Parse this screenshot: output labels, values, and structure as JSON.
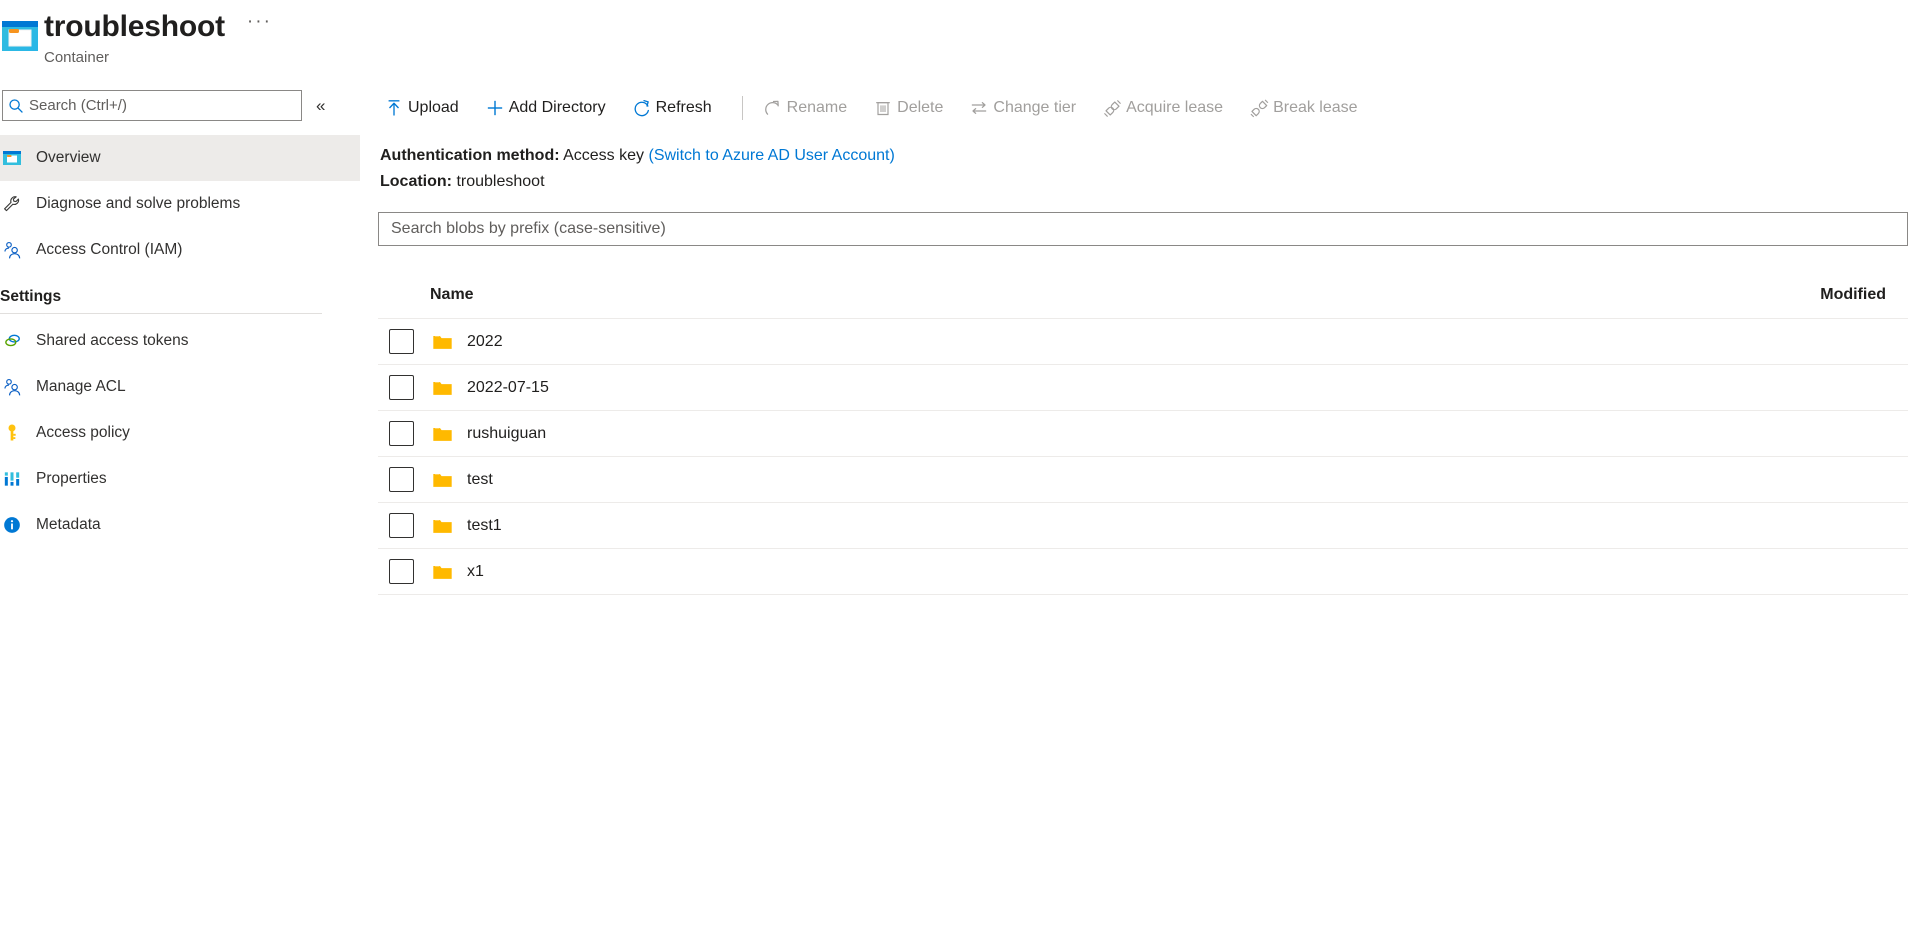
{
  "sidebar": {
    "icon": "storage-container-icon",
    "title": "troubleshoot",
    "subtitle": "Container",
    "more_label": "···",
    "search": {
      "placeholder": "Search (Ctrl+/)",
      "value": "",
      "icon": "search-icon"
    },
    "collapse_label": "«",
    "nav": [
      {
        "label": "Overview",
        "icon": "container-icon",
        "selected": true
      },
      {
        "label": "Diagnose and solve problems",
        "icon": "wrench-icon",
        "selected": false
      },
      {
        "label": "Access Control (IAM)",
        "icon": "people-icon",
        "selected": false
      }
    ],
    "section_title": "Settings",
    "settings": [
      {
        "label": "Shared access tokens",
        "icon": "link-chain-icon"
      },
      {
        "label": "Manage ACL",
        "icon": "people-icon"
      },
      {
        "label": "Access policy",
        "icon": "key-icon"
      },
      {
        "label": "Properties",
        "icon": "sliders-icon"
      },
      {
        "label": "Metadata",
        "icon": "info-circle-icon"
      }
    ]
  },
  "toolbar": {
    "buttons": [
      {
        "label": "Upload",
        "icon": "upload-icon",
        "disabled": false
      },
      {
        "label": "Add Directory",
        "icon": "plus-icon",
        "disabled": false
      },
      {
        "label": "Refresh",
        "icon": "refresh-icon",
        "disabled": false
      }
    ],
    "buttons_disabled": [
      {
        "label": "Rename",
        "icon": "rename-icon",
        "disabled": true
      },
      {
        "label": "Delete",
        "icon": "trash-icon",
        "disabled": true
      },
      {
        "label": "Change tier",
        "icon": "swap-arrows-icon",
        "disabled": true
      },
      {
        "label": "Acquire lease",
        "icon": "plug-connected-icon",
        "disabled": true
      },
      {
        "label": "Break lease",
        "icon": "plug-disconnected-icon",
        "disabled": true
      }
    ]
  },
  "info": {
    "auth_label": "Authentication method:",
    "auth_value": "Access key",
    "auth_switch_link": "(Switch to Azure AD User Account)",
    "location_label": "Location:",
    "location_value": "troubleshoot"
  },
  "blob_search": {
    "placeholder": "Search blobs by prefix (case-sensitive)",
    "value": ""
  },
  "table": {
    "columns": {
      "name": "Name",
      "modified": "Modified"
    },
    "rows": [
      {
        "name": "2022",
        "icon": "folder-icon",
        "modified": "",
        "checked": false
      },
      {
        "name": "2022-07-15",
        "icon": "folder-icon",
        "modified": "",
        "checked": false
      },
      {
        "name": "rushuiguan",
        "icon": "folder-icon",
        "modified": "",
        "checked": false
      },
      {
        "name": "test",
        "icon": "folder-icon",
        "modified": "",
        "checked": false
      },
      {
        "name": "test1",
        "icon": "folder-icon",
        "modified": "",
        "checked": false
      },
      {
        "name": "x1",
        "icon": "folder-icon",
        "modified": "",
        "checked": false
      }
    ]
  },
  "colors": {
    "accent": "#0078d4",
    "link": "#0078d4",
    "folder": "#ffb900",
    "disabled_text": "#a19f9d",
    "selected_bg": "#edebe9"
  }
}
